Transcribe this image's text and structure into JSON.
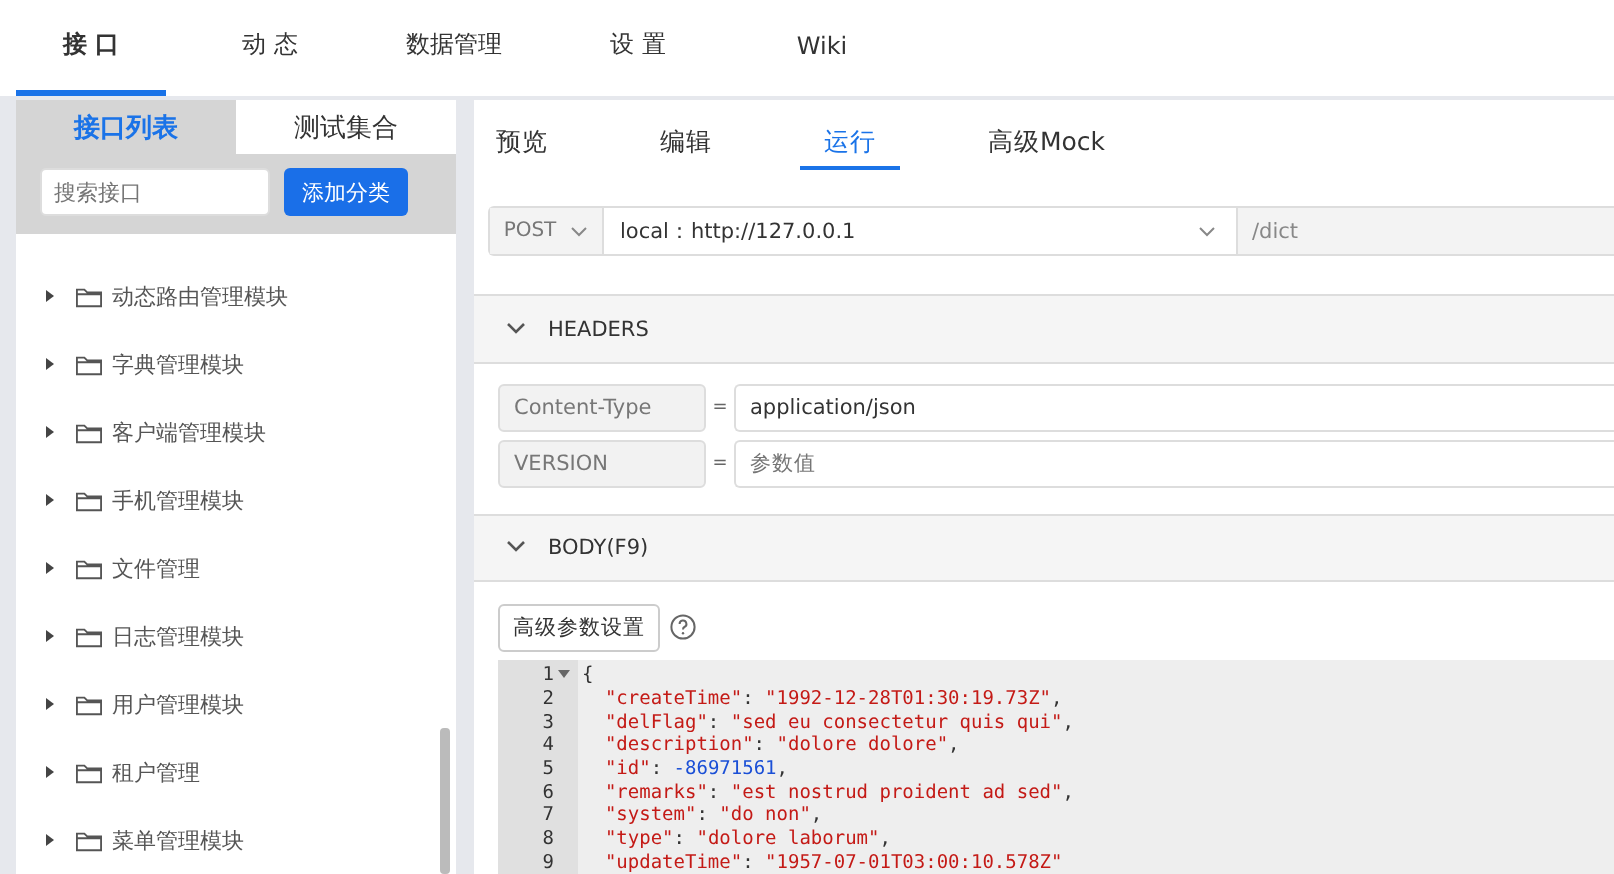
{
  "nav": {
    "tabs": [
      {
        "label": "接 口",
        "selected": true
      },
      {
        "label": "动 态",
        "selected": false
      },
      {
        "label": "数据管理",
        "selected": false
      },
      {
        "label": "设 置",
        "selected": false
      },
      {
        "label": "Wiki",
        "selected": false
      }
    ]
  },
  "sidebar": {
    "tabs": [
      {
        "label": "接口列表",
        "selected": true
      },
      {
        "label": "测试集合",
        "selected": false
      }
    ],
    "search": {
      "placeholder": "搜索接口"
    },
    "add_button": "添加分类",
    "items": [
      {
        "label": "动态路由管理模块",
        "expanded": false
      },
      {
        "label": "字典管理模块",
        "expanded": false
      },
      {
        "label": "客户端管理模块",
        "expanded": false
      },
      {
        "label": "手机管理模块",
        "expanded": false
      },
      {
        "label": "文件管理",
        "expanded": false
      },
      {
        "label": "日志管理模块",
        "expanded": false
      },
      {
        "label": "用户管理模块",
        "expanded": false
      },
      {
        "label": "租户管理",
        "expanded": false
      },
      {
        "label": "菜单管理模块",
        "expanded": false
      }
    ]
  },
  "main": {
    "tabs": [
      {
        "label": "预览",
        "selected": false
      },
      {
        "label": "编辑",
        "selected": false
      },
      {
        "label": "运行",
        "selected": true
      },
      {
        "label": "高级Mock",
        "selected": false
      }
    ],
    "request": {
      "method": "POST",
      "host": "local：http://127.0.0.1",
      "path": "/dict"
    },
    "headers": {
      "title": "HEADERS",
      "expanded": true,
      "rows": [
        {
          "name": "Content-Type",
          "equals": "=",
          "value": "application/json"
        },
        {
          "name": "VERSION",
          "equals": "=",
          "placeholder": "参数值"
        }
      ]
    },
    "body": {
      "title": "BODY(F9)",
      "expanded": true,
      "settings_button": "高级参数设置",
      "lines": [
        {
          "number": "1",
          "fold": true,
          "tokens": [
            {
              "kind": "punct",
              "text": "{"
            }
          ]
        },
        {
          "number": "2",
          "fold": false,
          "tokens": [
            {
              "kind": "key",
              "text": "  \"createTime\""
            },
            {
              "kind": "punct",
              "text": ": "
            },
            {
              "kind": "string",
              "text": "\"1992-12-28T01:30:19.73Z\""
            },
            {
              "kind": "punct",
              "text": ","
            }
          ]
        },
        {
          "number": "3",
          "fold": false,
          "tokens": [
            {
              "kind": "key",
              "text": "  \"delFlag\""
            },
            {
              "kind": "punct",
              "text": ": "
            },
            {
              "kind": "string",
              "text": "\"sed eu consectetur quis qui\""
            },
            {
              "kind": "punct",
              "text": ","
            }
          ]
        },
        {
          "number": "4",
          "fold": false,
          "tokens": [
            {
              "kind": "key",
              "text": "  \"description\""
            },
            {
              "kind": "punct",
              "text": ": "
            },
            {
              "kind": "string",
              "text": "\"dolore dolore\""
            },
            {
              "kind": "punct",
              "text": ","
            }
          ]
        },
        {
          "number": "5",
          "fold": false,
          "tokens": [
            {
              "kind": "key",
              "text": "  \"id\""
            },
            {
              "kind": "punct",
              "text": ": "
            },
            {
              "kind": "number",
              "text": "-86971561"
            },
            {
              "kind": "punct",
              "text": ","
            }
          ]
        },
        {
          "number": "6",
          "fold": false,
          "tokens": [
            {
              "kind": "key",
              "text": "  \"remarks\""
            },
            {
              "kind": "punct",
              "text": ": "
            },
            {
              "kind": "string",
              "text": "\"est nostrud proident ad sed\""
            },
            {
              "kind": "punct",
              "text": ","
            }
          ]
        },
        {
          "number": "7",
          "fold": false,
          "tokens": [
            {
              "kind": "key",
              "text": "  \"system\""
            },
            {
              "kind": "punct",
              "text": ": "
            },
            {
              "kind": "string",
              "text": "\"do non\""
            },
            {
              "kind": "punct",
              "text": ","
            }
          ]
        },
        {
          "number": "8",
          "fold": false,
          "tokens": [
            {
              "kind": "key",
              "text": "  \"type\""
            },
            {
              "kind": "punct",
              "text": ": "
            },
            {
              "kind": "string",
              "text": "\"dolore laborum\""
            },
            {
              "kind": "punct",
              "text": ","
            }
          ]
        },
        {
          "number": "9",
          "fold": false,
          "tokens": [
            {
              "kind": "key",
              "text": "  \"updateTime\""
            },
            {
              "kind": "punct",
              "text": ": "
            },
            {
              "kind": "string",
              "text": "\"1957-07-01T03:00:10.578Z\""
            }
          ]
        }
      ]
    }
  }
}
